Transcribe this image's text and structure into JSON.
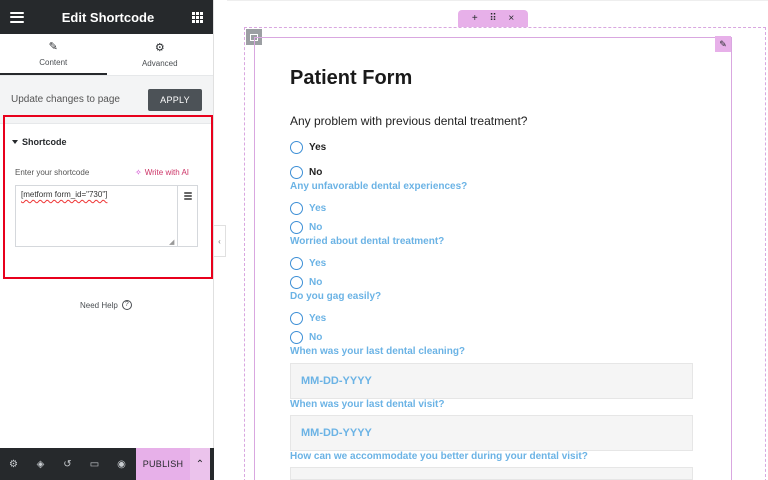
{
  "panel": {
    "title": "Edit Shortcode",
    "tabs": [
      {
        "label": "Content",
        "icon": "pencil-icon"
      },
      {
        "label": "Advanced",
        "icon": "gear-icon"
      }
    ],
    "update_label": "Update changes to page",
    "apply_label": "APPLY",
    "section_title": "Shortcode",
    "shortcode_label": "Enter your shortcode",
    "write_ai_label": "Write with AI",
    "shortcode_value": "[metform form_id=\"730\"]",
    "need_help": "Need Help",
    "publish_label": "PUBLISH"
  },
  "form": {
    "title": "Patient Form",
    "q1": "Any problem with previous dental treatment?",
    "yes": "Yes",
    "no": "No",
    "q2": "Any unfavorable dental experiences?",
    "q3": "Worried about dental treatment?",
    "q4": "Do you gag easily?",
    "q5": "When was your last dental cleaning?",
    "q6": "When was your last dental visit?",
    "q7": "How can we accommodate you better during your dental visit?",
    "date_placeholder": "MM-DD-YYYY"
  },
  "colors": {
    "accent": "#e7b0e9",
    "highlight_border": "#e8001c",
    "label_blue": "#6bb3e5",
    "header_dark": "#26292c"
  }
}
